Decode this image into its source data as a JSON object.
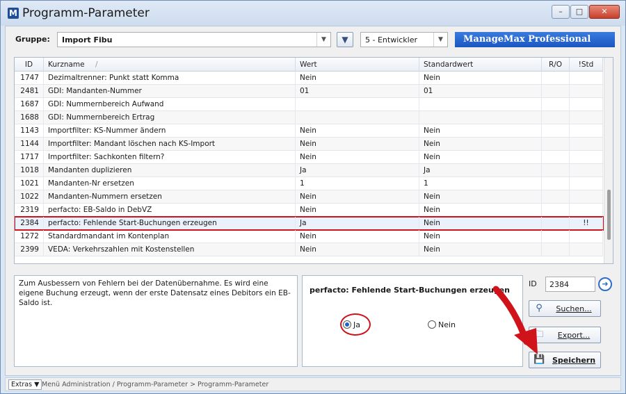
{
  "window": {
    "title": "Programm-Parameter",
    "app_icon_letter": "M"
  },
  "toolbar": {
    "gruppe_label": "Gruppe:",
    "gruppe_value": "Import Fibu",
    "level_value": "5 - Entwickler",
    "brand": "ManageMax Professional"
  },
  "grid": {
    "columns": {
      "id": "ID",
      "name": "Kurzname",
      "sort_marker": "/",
      "wert": "Wert",
      "std": "Standardwert",
      "ro": "R/O",
      "nstd": "!Std"
    },
    "rows": [
      {
        "id": "1747",
        "name": "Dezimaltrenner: Punkt statt Komma",
        "wert": "Nein",
        "std": "Nein",
        "ro": "",
        "nstd": ""
      },
      {
        "id": "2481",
        "name": "GDI: Mandanten-Nummer",
        "wert": "01",
        "std": "01",
        "ro": "",
        "nstd": ""
      },
      {
        "id": "1687",
        "name": "GDI: Nummernbereich Aufwand",
        "wert": "",
        "std": "",
        "ro": "",
        "nstd": ""
      },
      {
        "id": "1688",
        "name": "GDI: Nummernbereich Ertrag",
        "wert": "",
        "std": "",
        "ro": "",
        "nstd": ""
      },
      {
        "id": "1143",
        "name": "Importfilter: KS-Nummer ändern",
        "wert": "Nein",
        "std": "Nein",
        "ro": "",
        "nstd": ""
      },
      {
        "id": "1144",
        "name": "Importfilter: Mandant löschen nach KS-Import",
        "wert": "Nein",
        "std": "Nein",
        "ro": "",
        "nstd": ""
      },
      {
        "id": "1717",
        "name": "Importfilter: Sachkonten filtern?",
        "wert": "Nein",
        "std": "Nein",
        "ro": "",
        "nstd": ""
      },
      {
        "id": "1018",
        "name": "Mandanten duplizieren",
        "wert": "Ja",
        "std": "Ja",
        "ro": "",
        "nstd": ""
      },
      {
        "id": "1021",
        "name": "Mandanten-Nr ersetzen",
        "wert": "1",
        "std": "1",
        "ro": "",
        "nstd": ""
      },
      {
        "id": "1022",
        "name": "Mandanten-Nummern ersetzen",
        "wert": "Nein",
        "std": "Nein",
        "ro": "",
        "nstd": ""
      },
      {
        "id": "2319",
        "name": "perfacto: EB-Saldo in DebVZ",
        "wert": "Nein",
        "std": "Nein",
        "ro": "",
        "nstd": ""
      },
      {
        "id": "2384",
        "name": "perfacto: Fehlende Start-Buchungen erzeugen",
        "wert": "Ja",
        "std": "Nein",
        "ro": "",
        "nstd": "!!"
      },
      {
        "id": "1272",
        "name": "Standardmandant im Kontenplan",
        "wert": "Nein",
        "std": "Nein",
        "ro": "",
        "nstd": ""
      },
      {
        "id": "2399",
        "name": "VEDA: Verkehrszahlen mit Kostenstellen",
        "wert": "Nein",
        "std": "Nein",
        "ro": "",
        "nstd": ""
      }
    ],
    "selected_row": 11
  },
  "description": "Zum Ausbessern von Fehlern bei der Datenübernahme. Es wird eine eigene Buchung erzeugt, wenn der erste Datensatz eines Debitors ein EB-Saldo ist.",
  "editor": {
    "title": "perfacto: Fehlende Start-Buchungen erzeugen",
    "option_ja": "Ja",
    "option_nein": "Nein",
    "selected": "Ja"
  },
  "side": {
    "id_label": "ID",
    "id_value": "2384",
    "search_label": "Suchen...",
    "export_label": "Export...",
    "save_label": "Speichern"
  },
  "statusbar": {
    "extras_label": "Extras",
    "breadcrumb": "Menü Administration / Programm-Parameter > Programm-Parameter"
  },
  "colors": {
    "accent": "#1b56c0",
    "highlight": "#d0121b"
  }
}
